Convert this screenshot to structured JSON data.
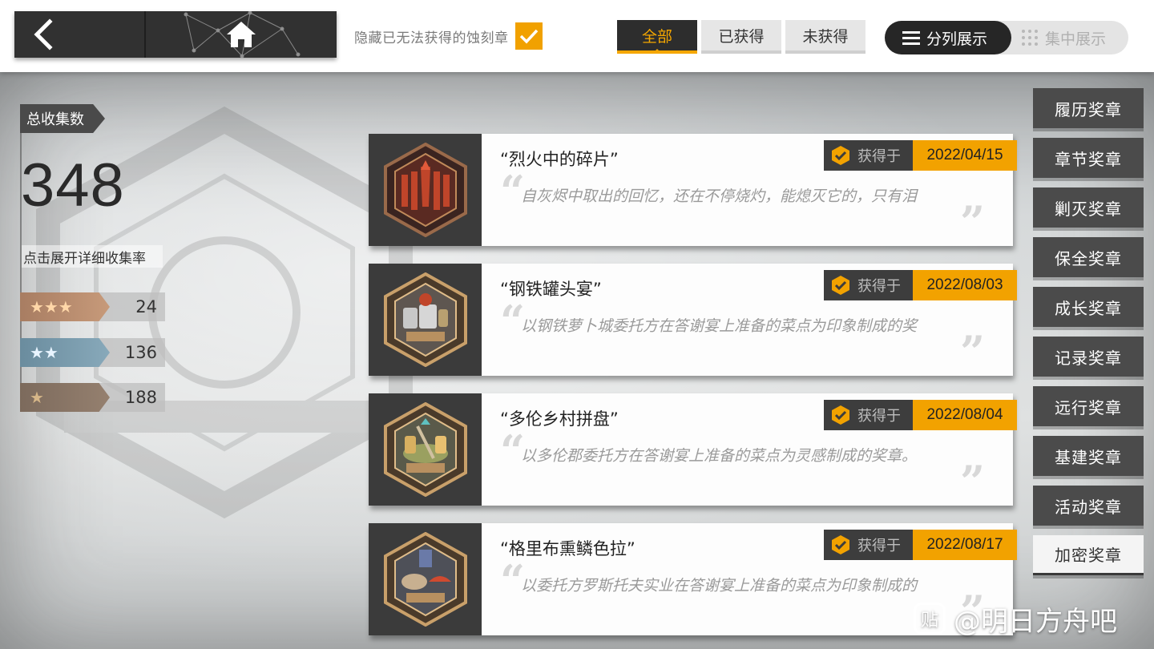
{
  "topbar": {
    "hide_unobtainable_label": "隐藏已无法获得的蚀刻章",
    "hide_unobtainable_checked": true,
    "filter_tabs": [
      {
        "label": "全部",
        "active": true
      },
      {
        "label": "已获得",
        "active": false
      },
      {
        "label": "未获得",
        "active": false
      }
    ],
    "view_modes": [
      {
        "label": "分列展示",
        "icon": "list-icon",
        "active": true
      },
      {
        "label": "集中展示",
        "icon": "grid-dots-icon",
        "active": false
      }
    ]
  },
  "stats": {
    "total_label": "总收集数",
    "total_value": "348",
    "detail_hint": "点击展开详细收集率",
    "rows": [
      {
        "stars": "★★★",
        "count": "24"
      },
      {
        "stars": "★★",
        "count": "136"
      },
      {
        "stars": "★",
        "count": "188"
      }
    ]
  },
  "medals": [
    {
      "title": "“烈火中的碎片”",
      "obtained_label": "获得于",
      "date": "2022/04/15",
      "desc": "自灰烬中取出的回忆，还在不停烧灼，能熄灭它的，只有泪",
      "icon": "fire-fragment-medal-icon"
    },
    {
      "title": "“钢铁罐头宴”",
      "obtained_label": "获得于",
      "date": "2022/08/03",
      "desc": "以钢铁萝卜城委托方在答谢宴上准备的菜点为印象制成的奖",
      "icon": "celebration-banquet-cans-medal-icon"
    },
    {
      "title": "“多伦乡村拼盘”",
      "obtained_label": "获得于",
      "date": "2022/08/04",
      "desc": "以多伦郡委托方在答谢宴上准备的菜点为灵感制成的奖章。",
      "icon": "celebration-banquet-platter-medal-icon"
    },
    {
      "title": "“格里布熏鳞色拉”",
      "obtained_label": "获得于",
      "date": "2022/08/17",
      "desc": "以委托方罗斯托夫实业在答谢宴上准备的菜点为印象制成的",
      "icon": "celebration-banquet-salad-medal-icon"
    }
  ],
  "categories": [
    {
      "label": "履历奖章",
      "active": false
    },
    {
      "label": "章节奖章",
      "active": false
    },
    {
      "label": "剿灭奖章",
      "active": false
    },
    {
      "label": "保全奖章",
      "active": false
    },
    {
      "label": "成长奖章",
      "active": false
    },
    {
      "label": "记录奖章",
      "active": false
    },
    {
      "label": "远行奖章",
      "active": false
    },
    {
      "label": "基建奖章",
      "active": false
    },
    {
      "label": "活动奖章",
      "active": false
    },
    {
      "label": "加密奖章",
      "active": true
    }
  ],
  "watermark": {
    "logo": "贴",
    "text": "@明日方舟吧"
  },
  "colors": {
    "accent": "#f2a200",
    "dark": "#313131",
    "card_bg": "#fdfdfd"
  }
}
